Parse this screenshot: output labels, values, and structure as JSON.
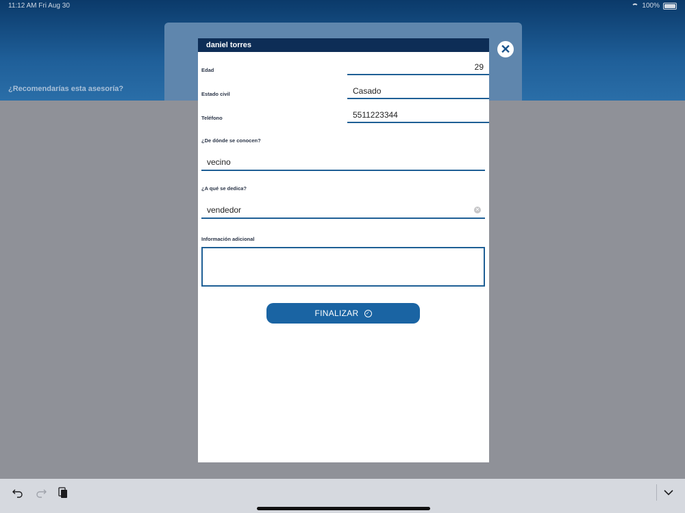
{
  "status_bar": {
    "time": "11:12 AM",
    "date": "Fri Aug 30",
    "battery": "100%"
  },
  "background": {
    "question": "¿Recomendarías esta asesoría?"
  },
  "modal": {
    "title": "daniel torres",
    "fields": {
      "edad": {
        "label": "Edad",
        "value": "29"
      },
      "estado_civil": {
        "label": "Estado civil",
        "value": "Casado"
      },
      "telefono": {
        "label": "Teléfono",
        "value": "5511223344"
      },
      "donde": {
        "label": "¿De dónde se conocen?",
        "value": "vecino"
      },
      "dedica": {
        "label": "¿A qué se dedica?",
        "value": "vendedor"
      },
      "info": {
        "label": "Información adicional",
        "value": ""
      }
    },
    "finish_label": "FINALIZAR"
  },
  "icons": {
    "close": "close-icon",
    "clear": "clear-icon",
    "check": "check-circle-icon",
    "undo": "undo-icon",
    "redo": "redo-icon",
    "paste": "paste-icon",
    "dismiss_keyboard": "chevron-down-icon"
  },
  "colors": {
    "header": "#0d2d56",
    "accent": "#1a64a3",
    "underline": "#1e5f95"
  }
}
